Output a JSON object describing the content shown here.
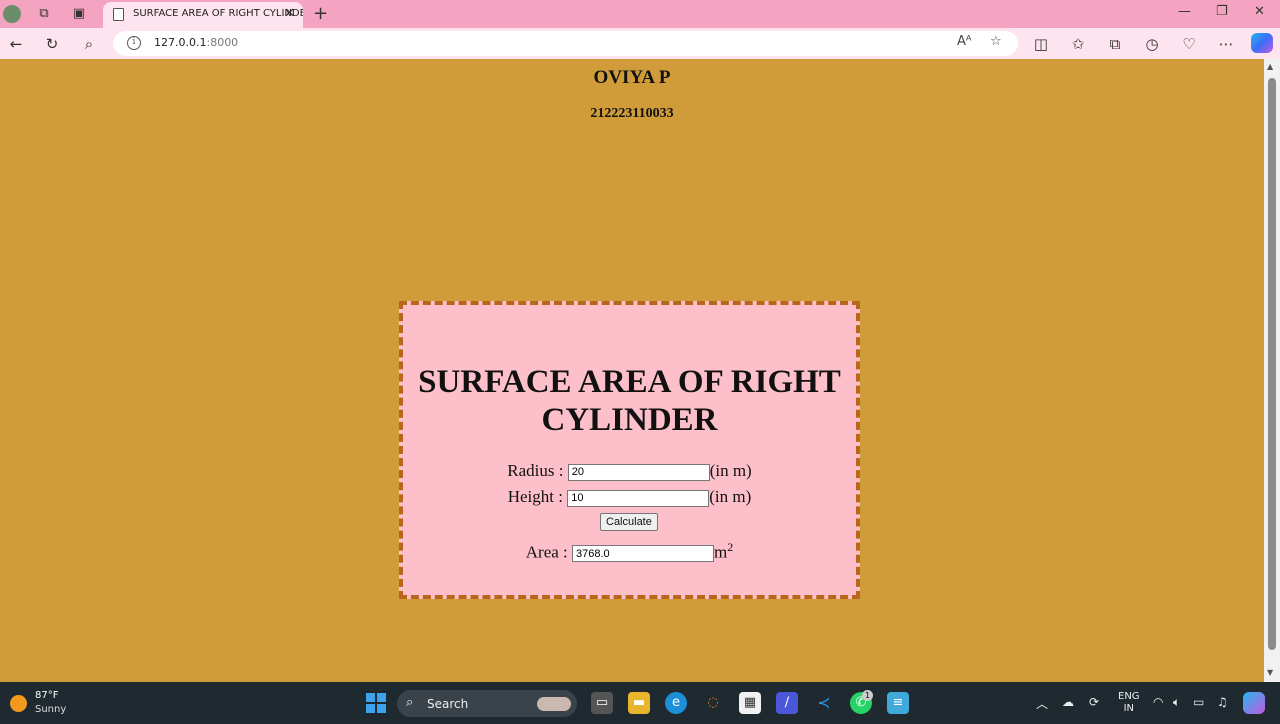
{
  "browser": {
    "tab_title": "SURFACE AREA OF RIGHT CYLINDER",
    "url_host": "127.0.0.1",
    "url_port": ":8000"
  },
  "page": {
    "name": "OVIYA P",
    "reg_no": "212223110033",
    "heading": "SURFACE AREA OF RIGHT CYLINDER",
    "radius_label": "Radius :",
    "radius_value": "20",
    "radius_unit": "(in m)",
    "height_label": "Height :",
    "height_value": "10",
    "height_unit": "(in m)",
    "calculate_label": "Calculate",
    "area_label": "Area :",
    "area_value": "3768.0",
    "area_unit": "m",
    "area_unit_sup": "2"
  },
  "taskbar": {
    "temperature": "87°F",
    "weather": "Sunny",
    "search_label": "Search",
    "lang_line1": "ENG",
    "lang_line2": "IN",
    "whatsapp_badge": "1"
  },
  "colors": {
    "page_bg": "#d09c3a",
    "card_bg": "#fdc0cb",
    "card_border": "#b8661a",
    "tabbar_bg": "#f4a3c0"
  }
}
